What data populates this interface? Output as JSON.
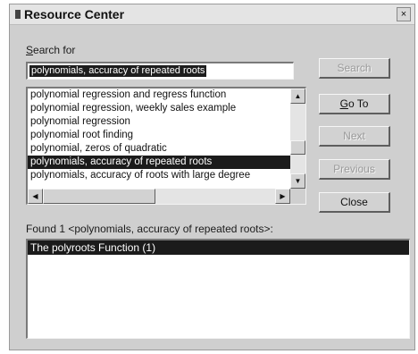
{
  "window": {
    "title": "Resource Center",
    "close_glyph": "×"
  },
  "search": {
    "label": "Search for",
    "value": "polynomials, accuracy of repeated roots"
  },
  "buttons": {
    "search": "Search",
    "goto": "Go To",
    "next": "Next",
    "previous": "Previous",
    "close": "Close"
  },
  "topics": [
    "polynomial regression and regress function",
    "polynomial regression, weekly sales example",
    "polynomial regression",
    "polynomial root finding",
    "polynomial, zeros of quadratic",
    "polynomials, accuracy of repeated roots",
    "polynomials, accuracy of roots with large degree"
  ],
  "selected_topic_index": 5,
  "scroll_glyphs": {
    "up": "▲",
    "down": "▼",
    "left": "◀",
    "right": "▶"
  },
  "found": {
    "label": "Found 1  <polynomials, accuracy of repeated roots>:",
    "results": [
      "The polyroots Function  (1)"
    ]
  }
}
